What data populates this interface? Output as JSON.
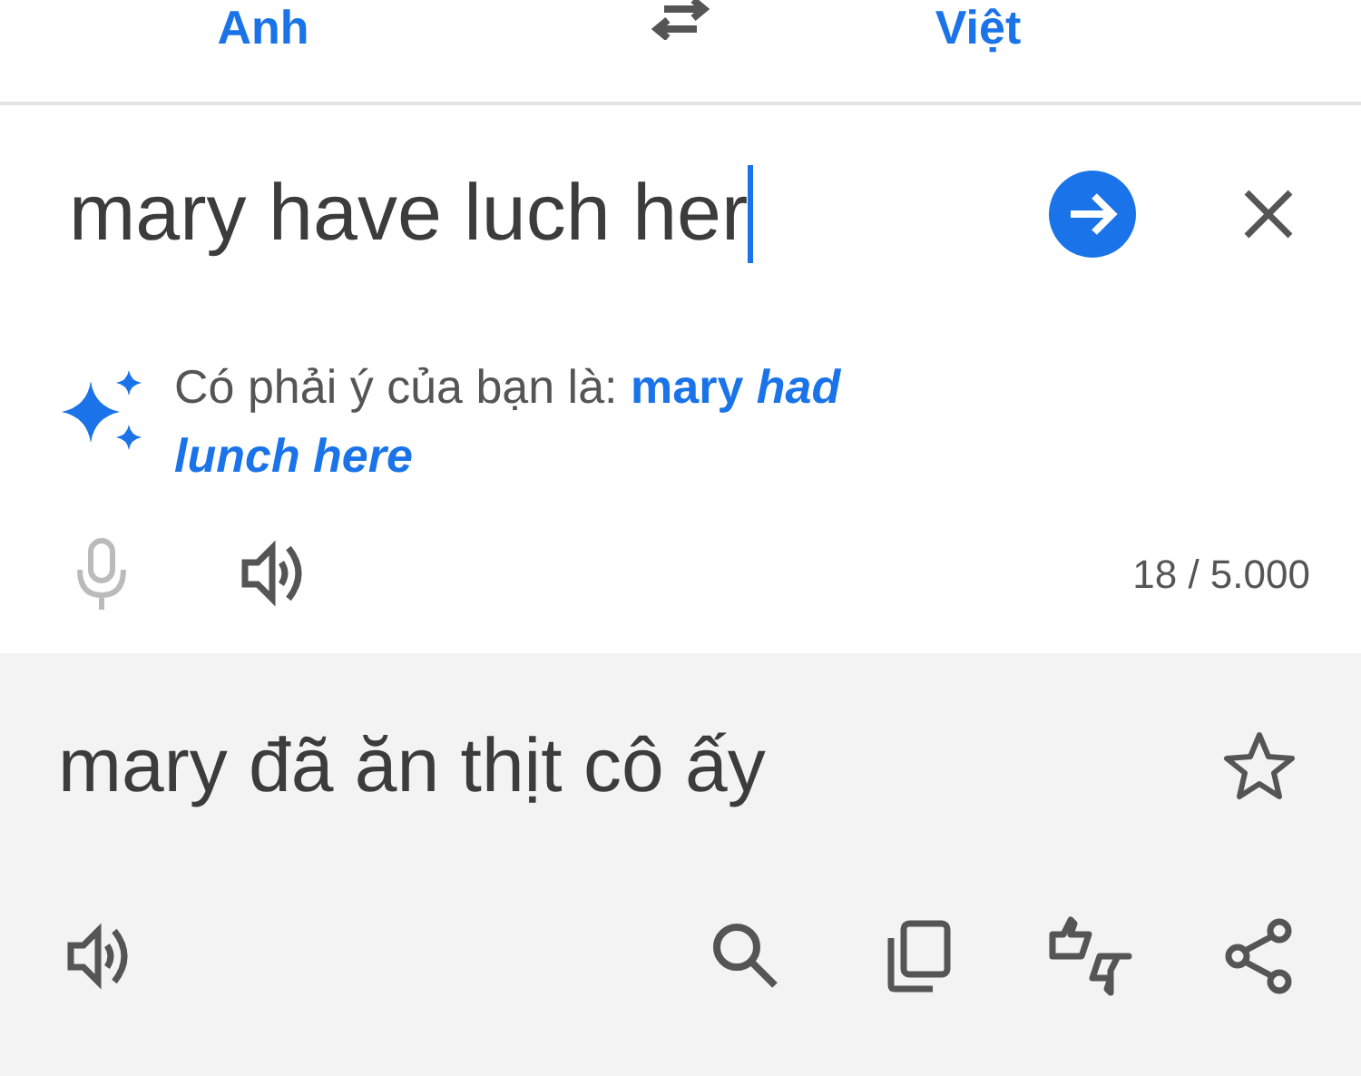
{
  "languages": {
    "source": "Anh",
    "target": "Việt"
  },
  "input": {
    "value": "mary have luch her",
    "counter": "18 / 5.000"
  },
  "suggestion": {
    "prefix": "Có phải ý của bạn là:",
    "correction": "mary **had lunch here**"
  },
  "translation": {
    "text": "mary đã ăn thịt cô ấy"
  }
}
